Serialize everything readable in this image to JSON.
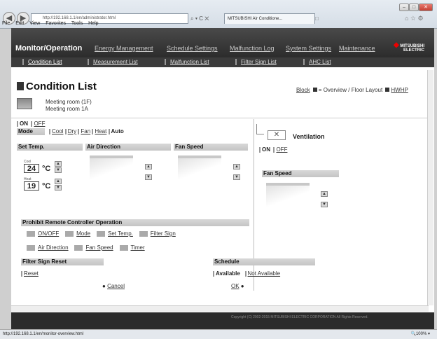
{
  "browser": {
    "url": "http://192.168.1.1/en/administrator.html",
    "url_controls": "⌕ ▾ C ✕",
    "tab_title": "MITSUBISHI Air Conditione...",
    "menu": [
      "File",
      "Edit",
      "View",
      "Favorites",
      "Tools",
      "Help"
    ],
    "status_url": "http://192.168.1.1/en/monitor-overview.html",
    "zoom": "100%"
  },
  "nav": {
    "title": "Monitor/Operation",
    "items": [
      "Energy Management",
      "Schedule Settings",
      "Malfunction Log",
      "System Settings",
      "Maintenance"
    ],
    "sub_items": [
      "Condition List",
      "Measurement List",
      "Malfunction List",
      "Filter Sign List",
      "AHC List"
    ],
    "logo": [
      "MITSUBISHI",
      "ELECTRIC"
    ]
  },
  "page": {
    "title": "Condition List",
    "block_link": "Block",
    "overview_link": "= Overview / Floor Layout",
    "hwhp_link": "HWHP",
    "groups": [
      "Meeting room (1F)",
      "Meeting room 1A"
    ]
  },
  "onoff": {
    "on": "ON",
    "off": "OFF"
  },
  "mode": {
    "label": "Mode",
    "options": [
      "Cool",
      "Dry",
      "Fan",
      "Heat"
    ],
    "active": "Auto"
  },
  "temp": {
    "label": "Set Temp.",
    "cool_label": "Cool",
    "cool_value": "24",
    "heat_label": "Heat",
    "heat_value": "19",
    "unit": "°C"
  },
  "air_direction": {
    "label": "Air Direction"
  },
  "fan_speed": {
    "label": "Fan Speed"
  },
  "ventilation": {
    "label": "Ventilation",
    "on": "ON",
    "off": "OFF",
    "fan_speed_label": "Fan Speed"
  },
  "prohibit": {
    "label": "Prohibit Remote Controller Operation",
    "items": [
      "ON/OFF",
      "Mode",
      "Set Temp.",
      "Filter Sign",
      "Air Direction",
      "Fan Speed",
      "Timer"
    ]
  },
  "filter_reset": {
    "label": "Filter Sign Reset",
    "reset": "Reset"
  },
  "schedule": {
    "label": "Schedule",
    "available": "Available",
    "not_available": "Not Available"
  },
  "actions": {
    "cancel": "Cancel",
    "ok": "OK"
  },
  "footer": {
    "copyright": "Copyright (C) 2002-2015 MITSUBISHI ELECTRIC CORPORATION All Rights Reserved."
  }
}
